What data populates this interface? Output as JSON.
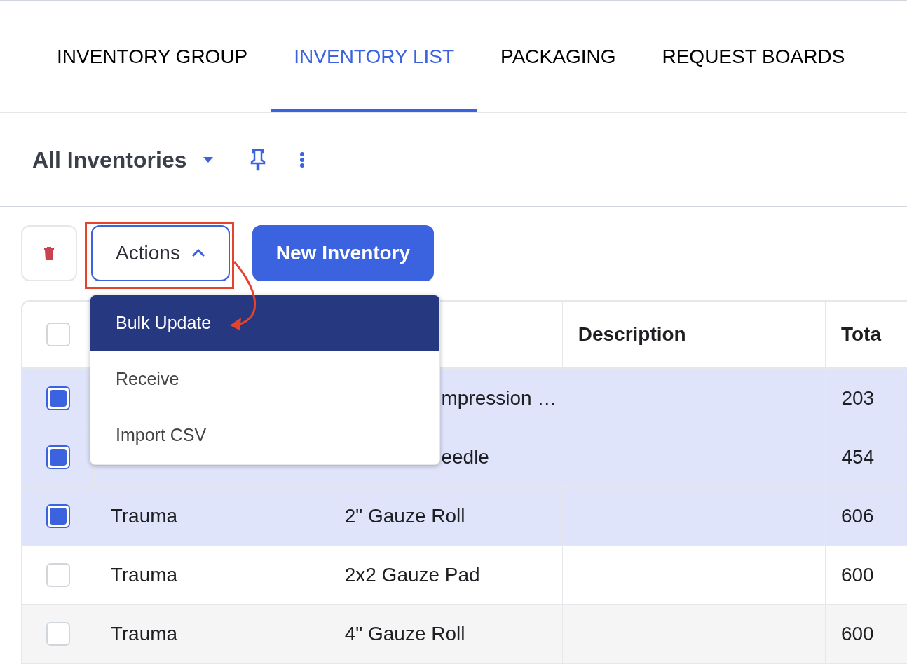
{
  "tabs": [
    {
      "label": "INVENTORY GROUP",
      "selected": false
    },
    {
      "label": "INVENTORY LIST",
      "selected": true
    },
    {
      "label": "PACKAGING",
      "selected": false
    },
    {
      "label": "REQUEST BOARDS",
      "selected": false
    }
  ],
  "view": {
    "title": "All Inventories"
  },
  "toolbar": {
    "actions_label": "Actions",
    "actions_open": true,
    "new_label": "New Inventory"
  },
  "menu": [
    {
      "label": "Bulk Update",
      "selected": true
    },
    {
      "label": "Receive",
      "selected": false
    },
    {
      "label": "Import CSV",
      "selected": false
    }
  ],
  "table": {
    "all_checked": false,
    "columns": [
      "",
      "",
      "Description",
      "Tota"
    ],
    "rows": [
      {
        "checked": true,
        "cells": [
          "",
          "mpression …",
          "",
          "203"
        ],
        "clipped": true
      },
      {
        "checked": true,
        "cells": [
          "",
          "eedle",
          "",
          "454"
        ],
        "clipped": true
      },
      {
        "checked": true,
        "cells": [
          "Trauma",
          "2\" Gauze Roll",
          "",
          "606"
        ],
        "clipped": false
      },
      {
        "checked": false,
        "cells": [
          "Trauma",
          "2x2 Gauze Pad",
          "",
          "600"
        ],
        "clipped": false
      },
      {
        "checked": false,
        "cells": [
          "Trauma",
          "4\" Gauze Roll",
          "",
          "600"
        ],
        "clipped": false
      }
    ]
  }
}
